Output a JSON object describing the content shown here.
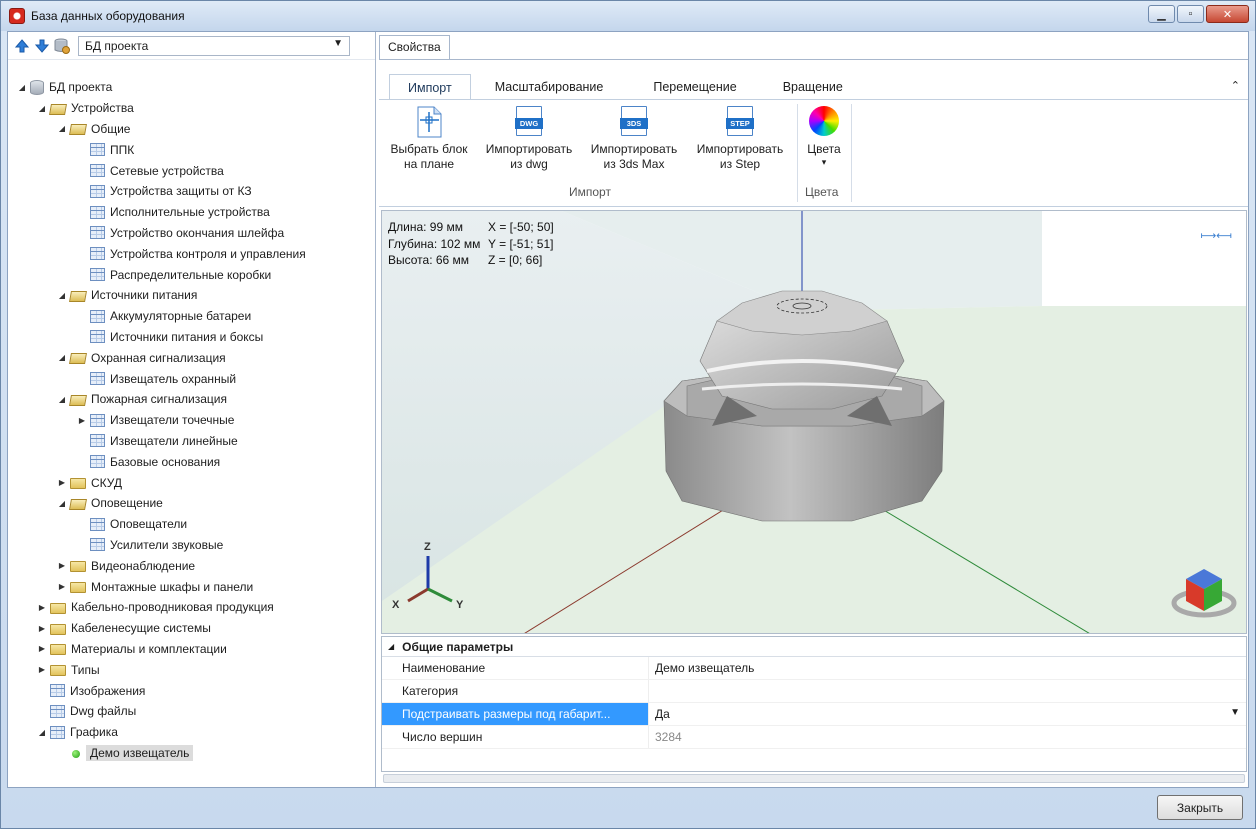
{
  "window": {
    "title": "База данных оборудования",
    "buttons": {
      "minimize": "▁",
      "maximize": "▫",
      "close": "✕"
    }
  },
  "left": {
    "combo_value": "БД проекта",
    "tree": [
      {
        "label": "БД проекта",
        "level": 0,
        "expander": "open",
        "icon": "database-icon"
      },
      {
        "label": "Устройства",
        "level": 1,
        "expander": "open",
        "icon": "folder-open-icon"
      },
      {
        "label": "Общие",
        "level": 2,
        "expander": "open",
        "icon": "folder-open-icon"
      },
      {
        "label": "ППК",
        "level": 3,
        "expander": "none",
        "icon": "table-icon"
      },
      {
        "label": "Сетевые устройства",
        "level": 3,
        "expander": "none",
        "icon": "table-icon"
      },
      {
        "label": "Устройства защиты от КЗ",
        "level": 3,
        "expander": "none",
        "icon": "table-icon"
      },
      {
        "label": "Исполнительные устройства",
        "level": 3,
        "expander": "none",
        "icon": "table-icon"
      },
      {
        "label": "Устройство окончания шлейфа",
        "level": 3,
        "expander": "none",
        "icon": "table-icon"
      },
      {
        "label": "Устройства контроля и управления",
        "level": 3,
        "expander": "none",
        "icon": "table-icon"
      },
      {
        "label": "Распределительные коробки",
        "level": 3,
        "expander": "none",
        "icon": "table-icon"
      },
      {
        "label": "Источники питания",
        "level": 2,
        "expander": "open",
        "icon": "folder-open-icon"
      },
      {
        "label": "Аккумуляторные батареи",
        "level": 3,
        "expander": "none",
        "icon": "table-icon"
      },
      {
        "label": "Источники питания и боксы",
        "level": 3,
        "expander": "none",
        "icon": "table-icon"
      },
      {
        "label": "Охранная сигнализация",
        "level": 2,
        "expander": "open",
        "icon": "folder-open-icon"
      },
      {
        "label": "Извещатель охранный",
        "level": 3,
        "expander": "none",
        "icon": "table-icon"
      },
      {
        "label": "Пожарная сигнализация",
        "level": 2,
        "expander": "open",
        "icon": "folder-open-icon"
      },
      {
        "label": "Извещатели точечные",
        "level": 3,
        "expander": "closed",
        "icon": "table-icon"
      },
      {
        "label": "Извещатели линейные",
        "level": 3,
        "expander": "none",
        "icon": "table-icon"
      },
      {
        "label": "Базовые основания",
        "level": 3,
        "expander": "none",
        "icon": "table-icon"
      },
      {
        "label": "СКУД",
        "level": 2,
        "expander": "closed",
        "icon": "folder-icon"
      },
      {
        "label": "Оповещение",
        "level": 2,
        "expander": "open",
        "icon": "folder-open-icon"
      },
      {
        "label": "Оповещатели",
        "level": 3,
        "expander": "none",
        "icon": "table-icon"
      },
      {
        "label": "Усилители звуковые",
        "level": 3,
        "expander": "none",
        "icon": "table-icon"
      },
      {
        "label": "Видеонаблюдение",
        "level": 2,
        "expander": "closed",
        "icon": "folder-icon"
      },
      {
        "label": "Монтажные шкафы и панели",
        "level": 2,
        "expander": "closed",
        "icon": "folder-icon"
      },
      {
        "label": "Кабельно-проводниковая продукция",
        "level": 1,
        "expander": "closed",
        "icon": "folder-icon"
      },
      {
        "label": "Кабеленесущие системы",
        "level": 1,
        "expander": "closed",
        "icon": "folder-icon"
      },
      {
        "label": "Материалы и комплектации",
        "level": 1,
        "expander": "closed",
        "icon": "folder-icon"
      },
      {
        "label": "Типы",
        "level": 1,
        "expander": "closed",
        "icon": "folder-icon"
      },
      {
        "label": "Изображения",
        "level": 1,
        "expander": "none",
        "icon": "table-icon"
      },
      {
        "label": "Dwg файлы",
        "level": 1,
        "expander": "none",
        "icon": "table-icon"
      },
      {
        "label": "Графика",
        "level": 1,
        "expander": "open",
        "icon": "table-icon"
      },
      {
        "label": "Демо извещатель",
        "level": 2,
        "expander": "none",
        "icon": "green-dot-icon",
        "selected": true
      }
    ]
  },
  "right": {
    "props_tab": "Свойства",
    "ribbon_tabs": [
      "Импорт",
      "Масштабирование",
      "Перемещение",
      "Вращение"
    ],
    "ribbon_collapse": "⌃",
    "buttons": {
      "select_block": "Выбрать блок\nна плане",
      "import_dwg": "Импортировать\nиз dwg",
      "import_3ds": "Импортировать\nиз 3ds Max",
      "import_step": "Импортировать\nиз Step",
      "colors": "Цвета"
    },
    "icon_tags": {
      "dwg": "DWG",
      "3ds": "3DS",
      "step": "STEP"
    },
    "colors_dropdown_arrow": "▾",
    "groups": {
      "import": "Импорт",
      "colors": "Цвета"
    },
    "dims": {
      "length": "Длина: 99 мм",
      "width": "Глубина: 102 мм",
      "height": "Высота: 66 мм",
      "x": "X = [-50; 50]",
      "y": "Y = [-51; 51]",
      "z": "Z = [0; 66]"
    },
    "axes": {
      "x": "X",
      "y": "Y",
      "z": "Z"
    },
    "propgrid": {
      "section": "Общие параметры",
      "rows": [
        {
          "name": "Наименование",
          "value": "Демо извещатель"
        },
        {
          "name": "Категория",
          "value": ""
        },
        {
          "name": "Подстраивать размеры под габарит...",
          "value": "Да"
        },
        {
          "name": "Число вершин",
          "value": "3284"
        }
      ]
    }
  },
  "footer": {
    "close_label": "Закрыть"
  }
}
